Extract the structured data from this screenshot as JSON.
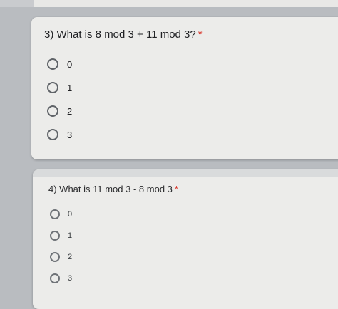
{
  "questions": [
    {
      "text": "3) What is 8 mod 3 + 11 mod 3?",
      "required_mark": "*",
      "options": [
        "0",
        "1",
        "2",
        "3"
      ]
    },
    {
      "text": "4) What is 11 mod 3 - 8 mod 3",
      "required_mark": "*",
      "options": [
        "0",
        "1",
        "2",
        "3"
      ]
    }
  ],
  "colors": {
    "required": "#d93025",
    "card": "#ececea",
    "radio_border": "#5f6368"
  }
}
